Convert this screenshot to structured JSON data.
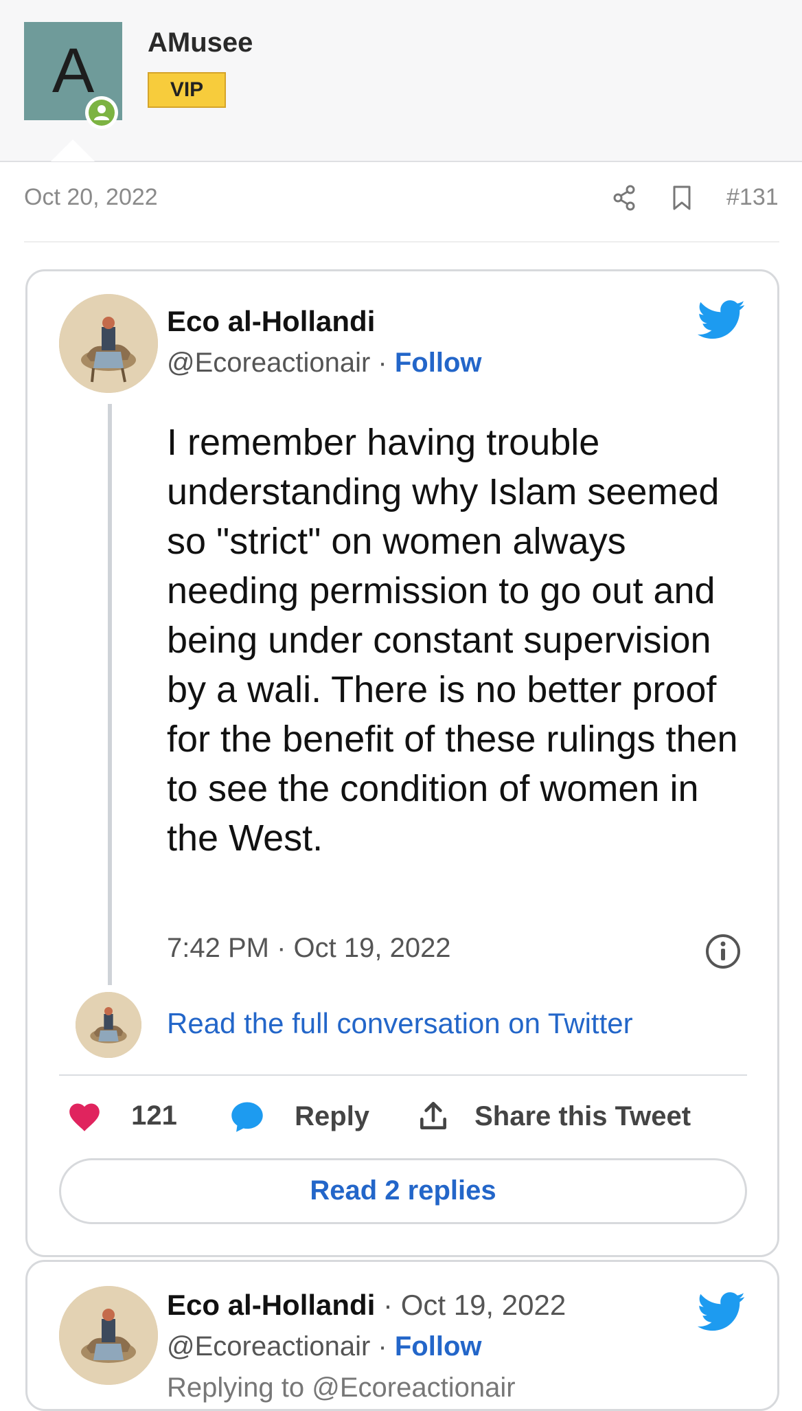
{
  "post": {
    "author": {
      "initial": "A",
      "username": "AMusee",
      "badge": "VIP"
    },
    "date": "Oct 20, 2022",
    "number": "#131",
    "icons": {
      "share": "share-icon",
      "bookmark": "bookmark-icon"
    }
  },
  "tweet": {
    "author_name": "Eco al-Hollandi",
    "handle": "@Ecoreactionair",
    "separator": " · ",
    "follow_label": "Follow",
    "text": "I remember having trouble understanding why Islam seemed so \"strict\" on women always needing permission to go out and being under constant supervision by a wali. There is no better proof for the benefit of these rulings then to see the condition of women in the West.",
    "timestamp": "7:42 PM · Oct 19, 2022",
    "read_full_label": "Read the full conversation on Twitter",
    "likes": "121",
    "reply_label": "Reply",
    "share_label": "Share this Tweet",
    "read_replies_label": "Read 2 replies"
  },
  "tweet2": {
    "author_name": "Eco al-Hollandi",
    "date": " · Oct 19, 2022",
    "handle": "@Ecoreactionair",
    "separator": " · ",
    "follow_label": "Follow",
    "replying_partial": "Replying to @Ecoreactionair"
  },
  "colors": {
    "link_blue": "#2366c9",
    "twitter_blue": "#1d9bf0",
    "heart": "#e0245e",
    "vip": "#f7cc3c"
  }
}
